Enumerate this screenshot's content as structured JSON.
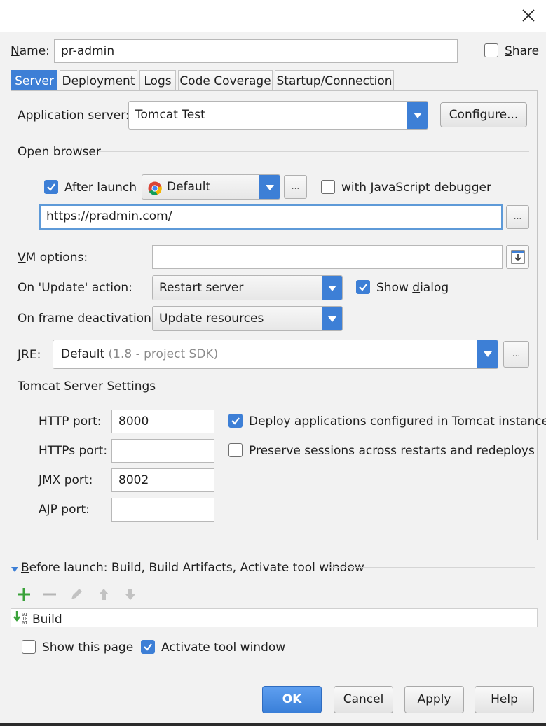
{
  "dialog": {
    "name_label": "Name:",
    "name_value": "pr-admin",
    "share_label": "Share",
    "share_checked": false
  },
  "tabs": [
    {
      "label": "Server",
      "active": true
    },
    {
      "label": "Deployment",
      "active": false
    },
    {
      "label": "Logs",
      "active": false
    },
    {
      "label": "Code Coverage",
      "active": false
    },
    {
      "label": "Startup/Connection",
      "active": false
    }
  ],
  "server": {
    "app_server_label": "Application server:",
    "app_server_value": "Tomcat Test",
    "configure_label": "Configure...",
    "open_browser_heading": "Open browser",
    "after_launch_label": "After launch",
    "after_launch_checked": true,
    "browser_value": "Default",
    "js_debugger_label": "with JavaScript debugger",
    "js_debugger_checked": false,
    "url_value": "https://pradmin.com/",
    "ellipsis": "...",
    "vm_options_label": "VM options:",
    "vm_options_value": "",
    "update_action_label": "On 'Update' action:",
    "update_action_value": "Restart server",
    "show_dialog_label": "Show dialog",
    "show_dialog_checked": true,
    "frame_deactivation_label": "On frame deactivation:",
    "frame_deactivation_value": "Update resources",
    "jre_label": "JRE:",
    "jre_value": "Default",
    "jre_hint": "(1.8 - project SDK)",
    "tomcat_heading": "Tomcat Server Settings",
    "http_port_label": "HTTP port:",
    "http_port_value": "8000",
    "https_port_label": "HTTPs port:",
    "https_port_value": "",
    "jmx_port_label": "JMX port:",
    "jmx_port_value": "8002",
    "ajp_port_label": "AJP port:",
    "ajp_port_value": "",
    "deploy_apps_label": "Deploy applications configured in Tomcat instance",
    "deploy_apps_checked": true,
    "preserve_sessions_label": "Preserve sessions across restarts and redeploys",
    "preserve_sessions_checked": false
  },
  "before_launch": {
    "heading": "Before launch: Build, Build Artifacts, Activate tool window",
    "items": [
      "Build"
    ],
    "show_page_label": "Show this page",
    "show_page_checked": false,
    "activate_tool_label": "Activate tool window",
    "activate_tool_checked": true
  },
  "footer": {
    "ok": "OK",
    "cancel": "Cancel",
    "apply": "Apply",
    "help": "Help"
  },
  "colors": {
    "accent": "#3d7fd6",
    "add_green": "#3aa23a"
  }
}
